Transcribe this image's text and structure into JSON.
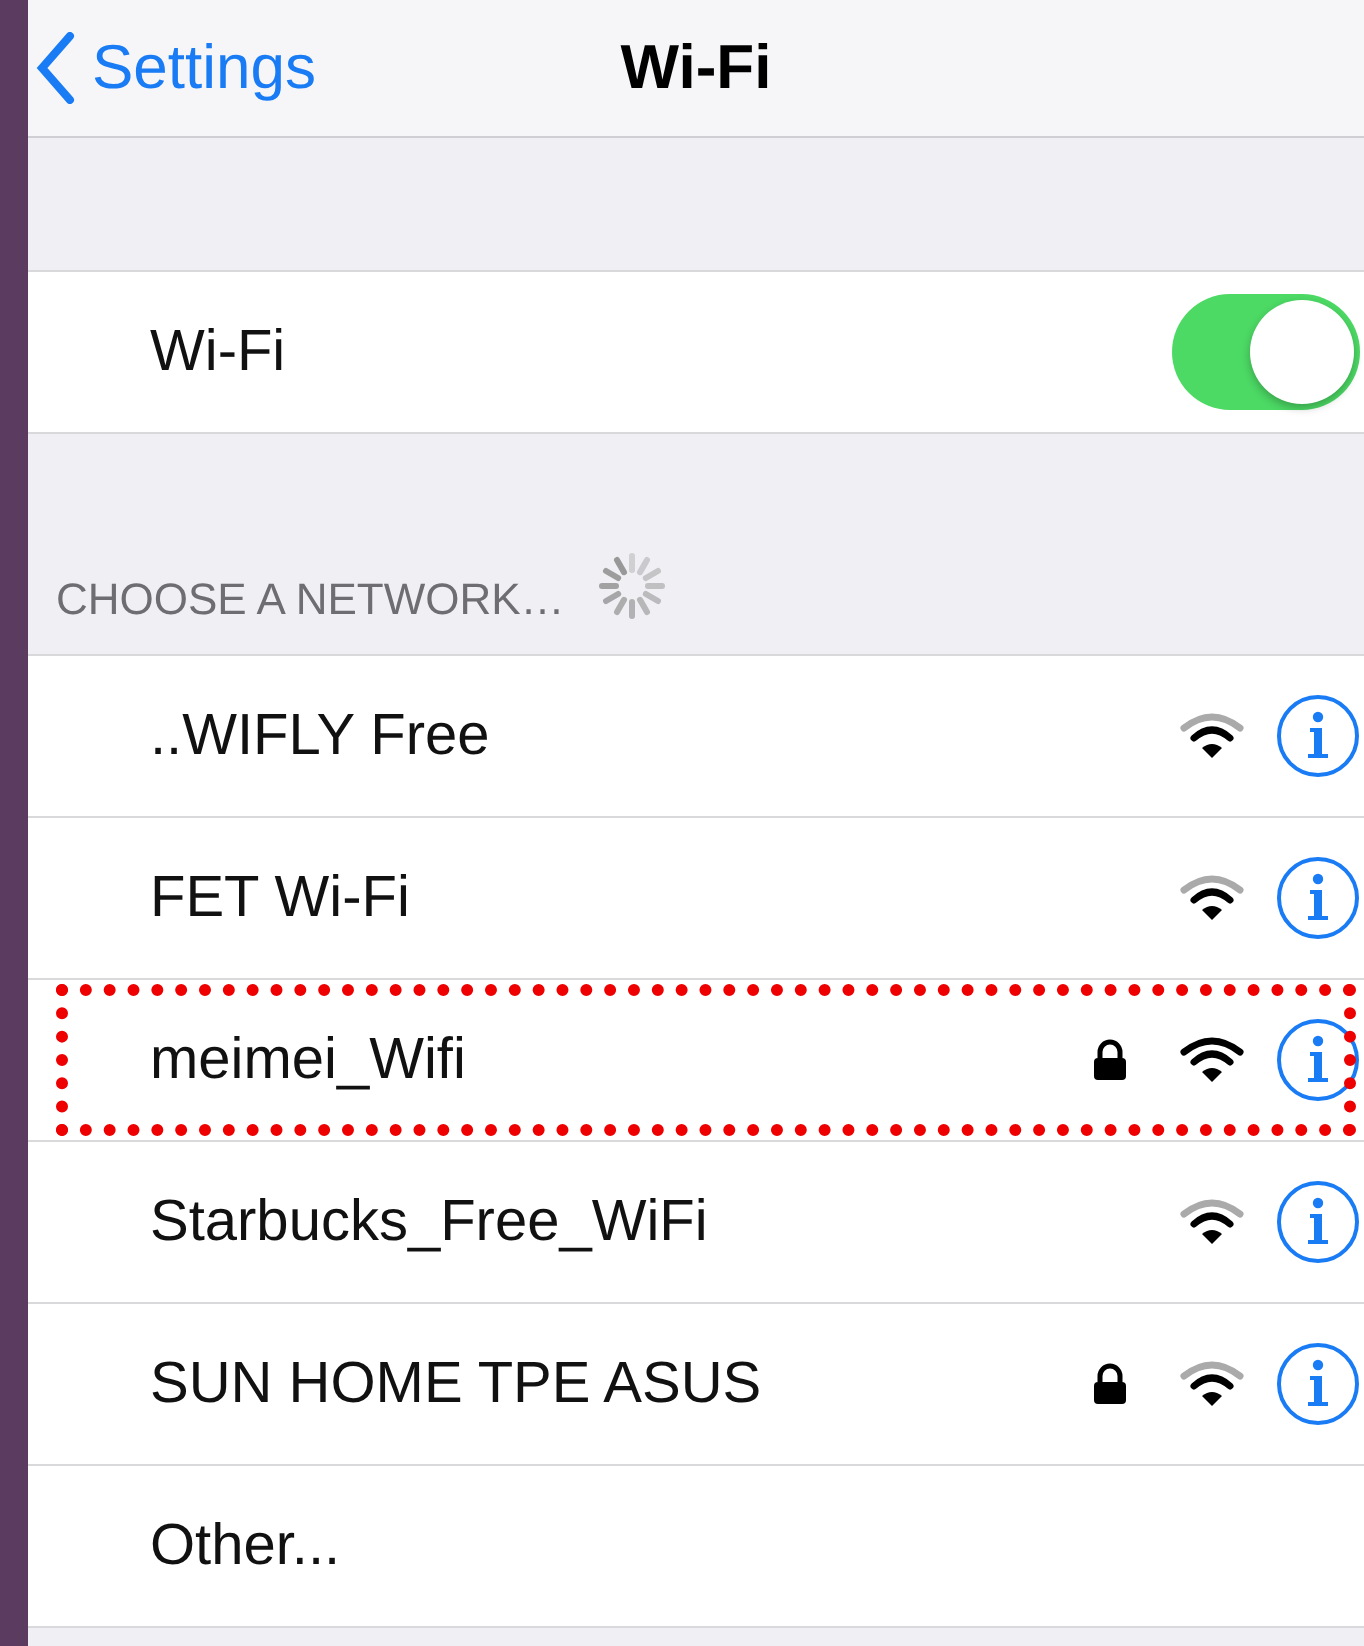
{
  "nav": {
    "back": "Settings",
    "title": "Wi-Fi"
  },
  "wifi": {
    "label": "Wi-Fi",
    "on": true
  },
  "section": {
    "header": "CHOOSE A NETWORK…",
    "loading": true
  },
  "networks": [
    {
      "name": "..WIFLY Free",
      "locked": false,
      "full_signal": false,
      "highlighted": false
    },
    {
      "name": "FET Wi-Fi",
      "locked": false,
      "full_signal": false,
      "highlighted": false
    },
    {
      "name": "meimei_Wifi",
      "locked": true,
      "full_signal": true,
      "highlighted": true
    },
    {
      "name": "Starbucks_Free_WiFi",
      "locked": false,
      "full_signal": false,
      "highlighted": false
    },
    {
      "name": "SUN HOME TPE ASUS",
      "locked": true,
      "full_signal": false,
      "highlighted": false
    }
  ],
  "other": "Other..."
}
